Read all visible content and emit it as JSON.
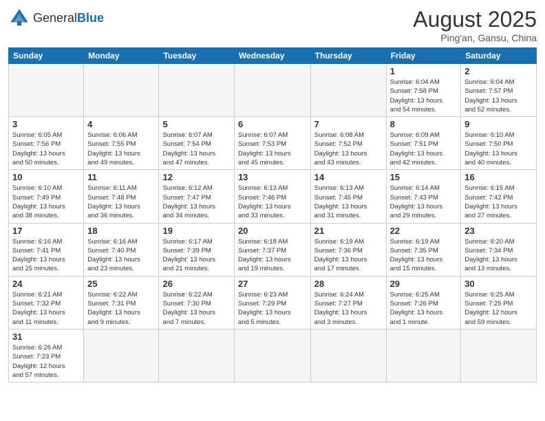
{
  "header": {
    "logo_general": "General",
    "logo_blue": "Blue",
    "month_year": "August 2025",
    "location": "Ping'an, Gansu, China"
  },
  "weekdays": [
    "Sunday",
    "Monday",
    "Tuesday",
    "Wednesday",
    "Thursday",
    "Friday",
    "Saturday"
  ],
  "weeks": [
    [
      {
        "day": "",
        "info": ""
      },
      {
        "day": "",
        "info": ""
      },
      {
        "day": "",
        "info": ""
      },
      {
        "day": "",
        "info": ""
      },
      {
        "day": "",
        "info": ""
      },
      {
        "day": "1",
        "info": "Sunrise: 6:04 AM\nSunset: 7:58 PM\nDaylight: 13 hours\nand 54 minutes."
      },
      {
        "day": "2",
        "info": "Sunrise: 6:04 AM\nSunset: 7:57 PM\nDaylight: 13 hours\nand 52 minutes."
      }
    ],
    [
      {
        "day": "3",
        "info": "Sunrise: 6:05 AM\nSunset: 7:56 PM\nDaylight: 13 hours\nand 50 minutes."
      },
      {
        "day": "4",
        "info": "Sunrise: 6:06 AM\nSunset: 7:55 PM\nDaylight: 13 hours\nand 49 minutes."
      },
      {
        "day": "5",
        "info": "Sunrise: 6:07 AM\nSunset: 7:54 PM\nDaylight: 13 hours\nand 47 minutes."
      },
      {
        "day": "6",
        "info": "Sunrise: 6:07 AM\nSunset: 7:53 PM\nDaylight: 13 hours\nand 45 minutes."
      },
      {
        "day": "7",
        "info": "Sunrise: 6:08 AM\nSunset: 7:52 PM\nDaylight: 13 hours\nand 43 minutes."
      },
      {
        "day": "8",
        "info": "Sunrise: 6:09 AM\nSunset: 7:51 PM\nDaylight: 13 hours\nand 42 minutes."
      },
      {
        "day": "9",
        "info": "Sunrise: 6:10 AM\nSunset: 7:50 PM\nDaylight: 13 hours\nand 40 minutes."
      }
    ],
    [
      {
        "day": "10",
        "info": "Sunrise: 6:10 AM\nSunset: 7:49 PM\nDaylight: 13 hours\nand 38 minutes."
      },
      {
        "day": "11",
        "info": "Sunrise: 6:11 AM\nSunset: 7:48 PM\nDaylight: 13 hours\nand 36 minutes."
      },
      {
        "day": "12",
        "info": "Sunrise: 6:12 AM\nSunset: 7:47 PM\nDaylight: 13 hours\nand 34 minutes."
      },
      {
        "day": "13",
        "info": "Sunrise: 6:13 AM\nSunset: 7:46 PM\nDaylight: 13 hours\nand 33 minutes."
      },
      {
        "day": "14",
        "info": "Sunrise: 6:13 AM\nSunset: 7:45 PM\nDaylight: 13 hours\nand 31 minutes."
      },
      {
        "day": "15",
        "info": "Sunrise: 6:14 AM\nSunset: 7:43 PM\nDaylight: 13 hours\nand 29 minutes."
      },
      {
        "day": "16",
        "info": "Sunrise: 6:15 AM\nSunset: 7:42 PM\nDaylight: 13 hours\nand 27 minutes."
      }
    ],
    [
      {
        "day": "17",
        "info": "Sunrise: 6:16 AM\nSunset: 7:41 PM\nDaylight: 13 hours\nand 25 minutes."
      },
      {
        "day": "18",
        "info": "Sunrise: 6:16 AM\nSunset: 7:40 PM\nDaylight: 13 hours\nand 23 minutes."
      },
      {
        "day": "19",
        "info": "Sunrise: 6:17 AM\nSunset: 7:39 PM\nDaylight: 13 hours\nand 21 minutes."
      },
      {
        "day": "20",
        "info": "Sunrise: 6:18 AM\nSunset: 7:37 PM\nDaylight: 13 hours\nand 19 minutes."
      },
      {
        "day": "21",
        "info": "Sunrise: 6:19 AM\nSunset: 7:36 PM\nDaylight: 13 hours\nand 17 minutes."
      },
      {
        "day": "22",
        "info": "Sunrise: 6:19 AM\nSunset: 7:35 PM\nDaylight: 13 hours\nand 15 minutes."
      },
      {
        "day": "23",
        "info": "Sunrise: 6:20 AM\nSunset: 7:34 PM\nDaylight: 13 hours\nand 13 minutes."
      }
    ],
    [
      {
        "day": "24",
        "info": "Sunrise: 6:21 AM\nSunset: 7:32 PM\nDaylight: 13 hours\nand 11 minutes."
      },
      {
        "day": "25",
        "info": "Sunrise: 6:22 AM\nSunset: 7:31 PM\nDaylight: 13 hours\nand 9 minutes."
      },
      {
        "day": "26",
        "info": "Sunrise: 6:22 AM\nSunset: 7:30 PM\nDaylight: 13 hours\nand 7 minutes."
      },
      {
        "day": "27",
        "info": "Sunrise: 6:23 AM\nSunset: 7:29 PM\nDaylight: 13 hours\nand 5 minutes."
      },
      {
        "day": "28",
        "info": "Sunrise: 6:24 AM\nSunset: 7:27 PM\nDaylight: 13 hours\nand 3 minutes."
      },
      {
        "day": "29",
        "info": "Sunrise: 6:25 AM\nSunset: 7:26 PM\nDaylight: 13 hours\nand 1 minute."
      },
      {
        "day": "30",
        "info": "Sunrise: 6:25 AM\nSunset: 7:25 PM\nDaylight: 12 hours\nand 59 minutes."
      }
    ],
    [
      {
        "day": "31",
        "info": "Sunrise: 6:26 AM\nSunset: 7:23 PM\nDaylight: 12 hours\nand 57 minutes."
      },
      {
        "day": "",
        "info": ""
      },
      {
        "day": "",
        "info": ""
      },
      {
        "day": "",
        "info": ""
      },
      {
        "day": "",
        "info": ""
      },
      {
        "day": "",
        "info": ""
      },
      {
        "day": "",
        "info": ""
      }
    ]
  ]
}
